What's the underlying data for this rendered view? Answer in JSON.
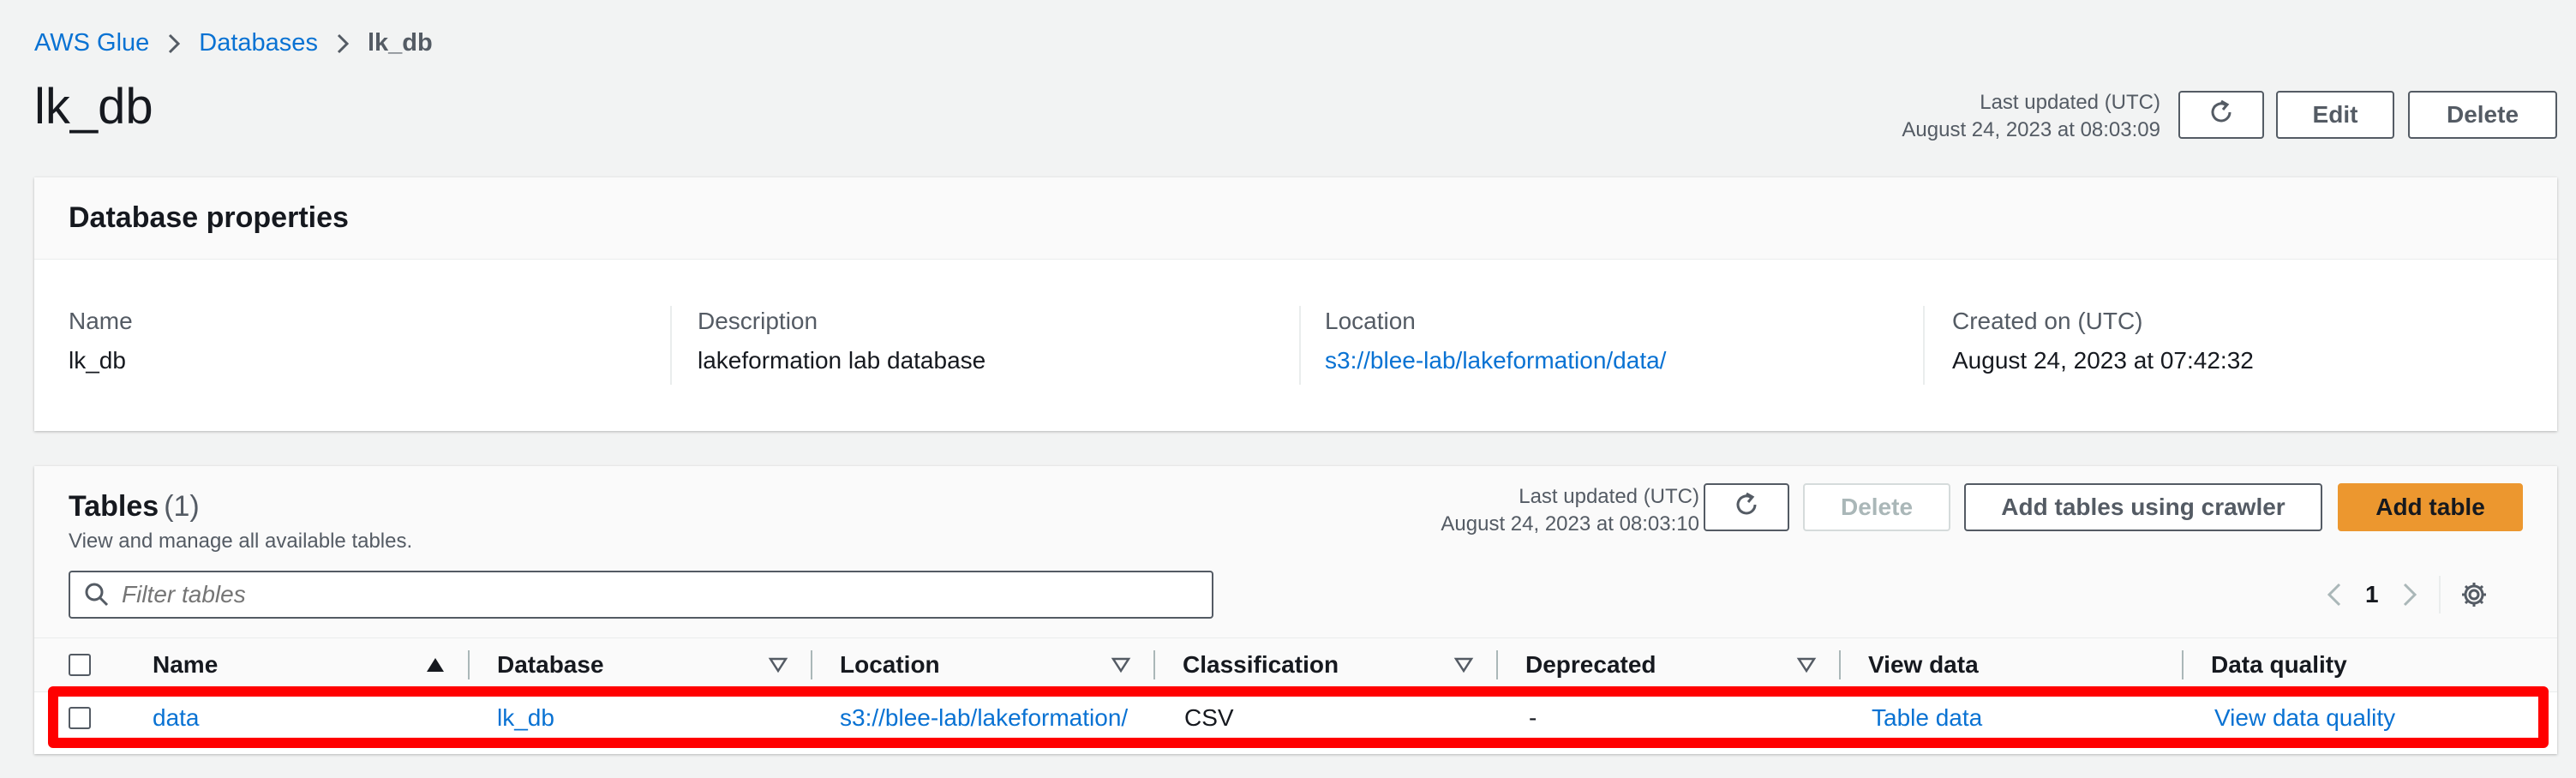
{
  "breadcrumb": {
    "root": "AWS Glue",
    "databases": "Databases",
    "current": "lk_db"
  },
  "page": {
    "title": "lk_db"
  },
  "header": {
    "updated_label": "Last updated (UTC)",
    "updated_value": "August 24, 2023 at 08:03:09",
    "edit": "Edit",
    "delete": "Delete"
  },
  "properties": {
    "title": "Database properties",
    "name_label": "Name",
    "name_value": "lk_db",
    "desc_label": "Description",
    "desc_value": "lakeformation lab database",
    "loc_label": "Location",
    "loc_value": "s3://blee-lab/lakeformation/data/",
    "created_label": "Created on (UTC)",
    "created_value": "August 24, 2023 at 07:42:32"
  },
  "tables": {
    "title": "Tables",
    "count": "(1)",
    "description": "View and manage all available tables.",
    "updated_label": "Last updated (UTC)",
    "updated_value": "August 24, 2023 at 08:03:10",
    "delete": "Delete",
    "crawler": "Add tables using crawler",
    "add": "Add table",
    "filter_placeholder": "Filter tables",
    "page": "1",
    "columns": [
      "Name",
      "Database",
      "Location",
      "Classification",
      "Deprecated",
      "View data",
      "Data quality"
    ],
    "rows": [
      {
        "name": "data",
        "database": "lk_db",
        "location": "s3://blee-lab/lakeformation/",
        "classification": "CSV",
        "deprecated": "-",
        "view_data": "Table data",
        "data_quality": "View data quality"
      }
    ]
  },
  "colors": {
    "link": "#0972d3",
    "primary": "#ec972f",
    "highlight": "#ff0000"
  },
  "icons": [
    "chevron-right-icon",
    "refresh-icon",
    "search-icon",
    "chevron-left-icon",
    "gear-icon",
    "sort-ascending-icon",
    "sort-icon"
  ]
}
